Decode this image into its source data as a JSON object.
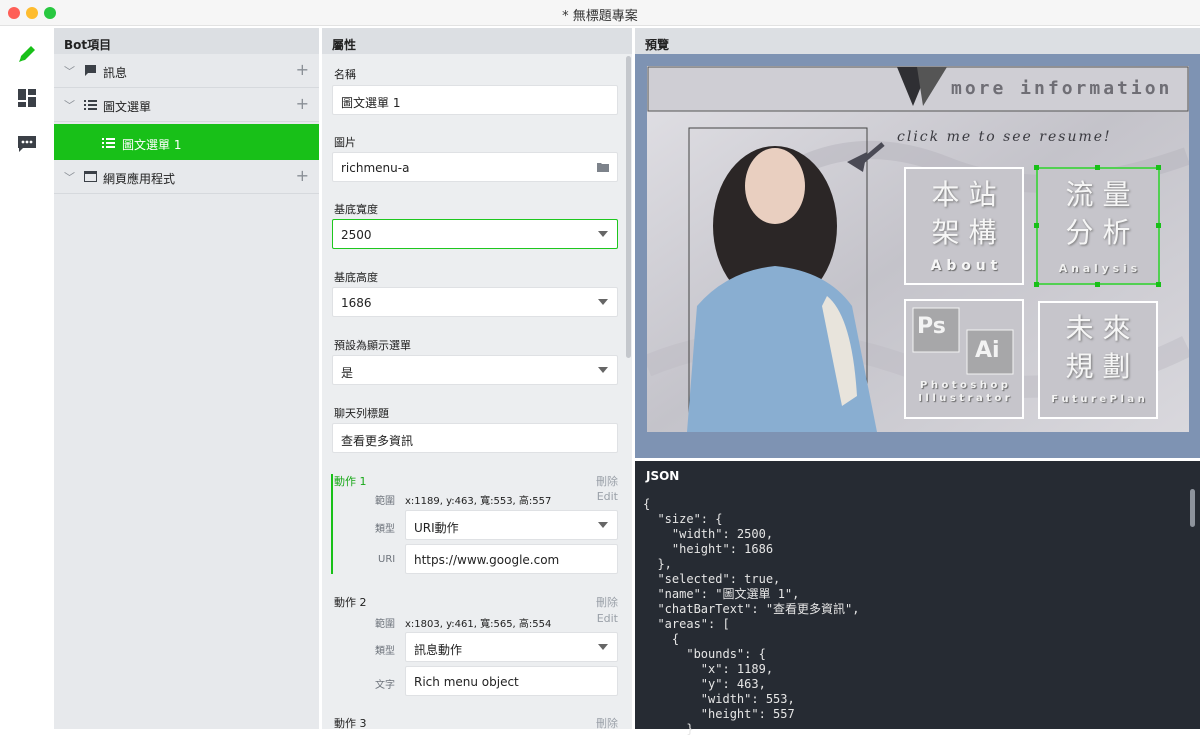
{
  "window": {
    "title": "* 無標題專案"
  },
  "rail": {
    "icons": [
      "pencil-icon",
      "dashboard-icon",
      "chat-icon"
    ]
  },
  "bot": {
    "header": "Bot項目",
    "items": [
      {
        "label": "訊息",
        "icon": "message-icon"
      },
      {
        "label": "圖文選單",
        "icon": "list-icon"
      },
      {
        "label": "圖文選單 1",
        "icon": "list-icon",
        "selected": true
      },
      {
        "label": "網頁應用程式",
        "icon": "webapp-icon"
      }
    ]
  },
  "props": {
    "header": "屬性",
    "name": {
      "label": "名稱",
      "value": "圖文選單 1"
    },
    "image": {
      "label": "圖片",
      "value": "richmenu-a"
    },
    "base_width": {
      "label": "基底寬度",
      "value": "2500"
    },
    "base_height": {
      "label": "基底高度",
      "value": "1686"
    },
    "default_menu": {
      "label": "預設為顯示選單",
      "value": "是"
    },
    "chatbar": {
      "label": "聊天列標題",
      "value": "查看更多資訊"
    },
    "actions": [
      {
        "title": "動作 1",
        "delete": "刪除",
        "edit": "Edit",
        "range_label": "範圍",
        "range": "x:1189, y:463, 寬:553, 高:557",
        "type_label": "類型",
        "type": "URI動作",
        "value_label": "URI",
        "value": "https://www.google.com"
      },
      {
        "title": "動作 2",
        "delete": "刪除",
        "edit": "Edit",
        "range_label": "範圍",
        "range": "x:1803, y:461, 寬:565, 高:554",
        "type_label": "類型",
        "type": "訊息動作",
        "value_label": "文字",
        "value": "Rich menu object"
      },
      {
        "title": "動作 3",
        "delete": "刪除"
      }
    ]
  },
  "preview": {
    "header": "預覽",
    "banner": "more information",
    "click": "click me to see resume!",
    "tiles": [
      {
        "line1": "本 站",
        "line2": "架 構",
        "sub": "A b o u t"
      },
      {
        "line1": "流 量",
        "line2": "分 析",
        "sub": "A n a l y s i s"
      },
      {
        "ps": "Ps",
        "ai": "Ai",
        "sub": "P h o t o s h o p",
        "sub2": "I l l u s t r a t o r"
      },
      {
        "line1": "未 來",
        "line2": "規 劃",
        "sub": "F u t u r e  P l a n"
      }
    ]
  },
  "json": {
    "header": "JSON",
    "lines": [
      "{",
      "  \"size\": {",
      "    \"width\": 2500,",
      "    \"height\": 1686",
      "  },",
      "  \"selected\": true,",
      "  \"name\": \"圖文選單 1\",",
      "  \"chatBarText\": \"查看更多資訊\",",
      "  \"areas\": [",
      "    {",
      "      \"bounds\": {",
      "        \"x\": 1189,",
      "        \"y\": 463,",
      "        \"width\": 553,",
      "        \"height\": 557",
      "      }"
    ]
  },
  "colors": {
    "accent": "#18c018",
    "panel": "#e7e9ec",
    "json_bg": "#262b33",
    "preview_bg": "#7e93b3"
  }
}
